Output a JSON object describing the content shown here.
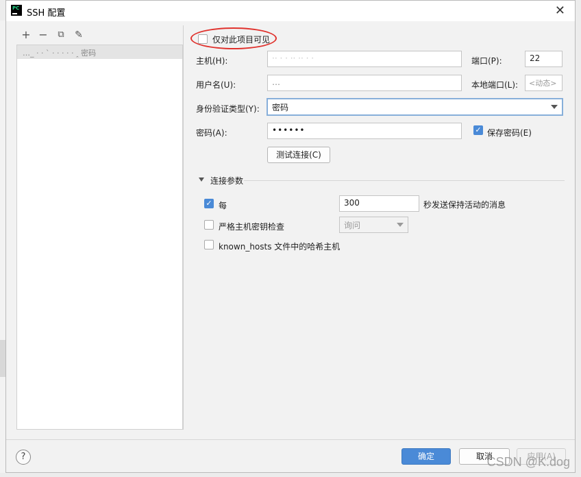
{
  "window": {
    "title": "SSH 配置",
    "app_icon_text": "PC",
    "close_glyph": "✕"
  },
  "toolbar": {
    "add": "+",
    "remove": "−",
    "copy": "⧉",
    "edit": "✎"
  },
  "host_list": {
    "items": [
      {
        "label": "…_ ·  · ` ·  ·  ·  ·  · ꞈ  密码"
      }
    ]
  },
  "form": {
    "only_this_project": {
      "label": "仅对此项目可见",
      "checked": false
    },
    "host": {
      "label": "主机(H):",
      "value": "·· · ·  ·· ·· ·  ·"
    },
    "port": {
      "label": "端口(P):",
      "value": "22"
    },
    "username": {
      "label": "用户名(U):",
      "value": "…"
    },
    "local_port": {
      "label": "本地端口(L):",
      "placeholder": "<动态>"
    },
    "auth_type": {
      "label": "身份验证类型(Y):",
      "value": "密码"
    },
    "password": {
      "label": "密码(A):",
      "value": "••••••"
    },
    "save_password": {
      "label": "保存密码(E)",
      "checked": true
    },
    "test_connection": "测试连接(C)"
  },
  "connection_params": {
    "section_title": "连接参数",
    "keepalive": {
      "label": "每",
      "value": "300",
      "suffix": "秒发送保持活动的消息",
      "checked": true
    },
    "strict_host_key": {
      "label": "严格主机密钥检查",
      "checked": false,
      "select_value": "询问"
    },
    "hash_known_hosts": {
      "label": "known_hosts 文件中的哈希主机",
      "checked": false
    }
  },
  "footer": {
    "help": "?",
    "ok": "确定",
    "cancel": "取消",
    "apply": "应用(A)"
  },
  "watermark": "CSDN @K.dog",
  "colors": {
    "accent": "#4a8ad7",
    "annotation": "#e0322d"
  }
}
